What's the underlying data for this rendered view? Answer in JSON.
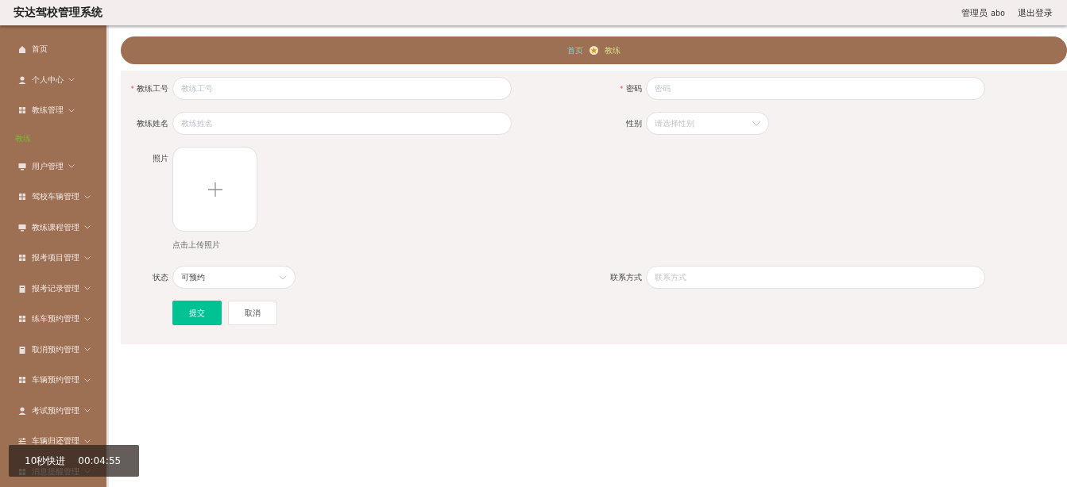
{
  "header": {
    "title": "安达驾校管理系统",
    "user_label": "管理员",
    "user_name": "abo",
    "logout": "退出登录"
  },
  "sidebar": {
    "items": [
      {
        "label": "首页",
        "has_arrow": false
      },
      {
        "label": "个人中心",
        "has_arrow": true
      },
      {
        "label": "教练管理",
        "has_arrow": true,
        "children": [
          {
            "label": "教练",
            "selected": true
          }
        ]
      },
      {
        "label": "用户管理",
        "has_arrow": true
      },
      {
        "label": "驾校车辆管理",
        "has_arrow": true
      },
      {
        "label": "教练课程管理",
        "has_arrow": true
      },
      {
        "label": "报考项目管理",
        "has_arrow": true
      },
      {
        "label": "报考记录管理",
        "has_arrow": true
      },
      {
        "label": "练车预约管理",
        "has_arrow": true
      },
      {
        "label": "取消预约管理",
        "has_arrow": true
      },
      {
        "label": "车辆预约管理",
        "has_arrow": true
      },
      {
        "label": "考试预约管理",
        "has_arrow": true
      },
      {
        "label": "车辆归还管理",
        "has_arrow": true
      },
      {
        "label": "消息提醒管理",
        "has_arrow": true
      }
    ]
  },
  "breadcrumb": [
    "首页",
    "教练"
  ],
  "form": {
    "rows": [
      [
        {
          "kind": "input",
          "label": "教练工号",
          "required_mark": "*",
          "placeholder": "教练工号"
        },
        {
          "kind": "input",
          "label": "密码",
          "required_mark": "*",
          "placeholder": "密码"
        }
      ],
      [
        {
          "kind": "input",
          "label": "教练姓名",
          "placeholder": "教练姓名"
        },
        {
          "kind": "select",
          "label": "性别",
          "placeholder": "请选择性别"
        }
      ],
      [
        {
          "kind": "upload",
          "label": "照片",
          "hint": "点击上传照片"
        }
      ],
      [
        {
          "kind": "select",
          "label": "状态",
          "value": "可预约"
        },
        {
          "kind": "input",
          "label": "联系方式",
          "placeholder": "联系方式"
        }
      ]
    ],
    "buttons": [
      {
        "label": "提交",
        "kind": "primary"
      },
      {
        "label": "取消",
        "kind": "plain"
      }
    ]
  },
  "player_overlay": {
    "label": "10秒快进",
    "time": "00:04:55"
  }
}
